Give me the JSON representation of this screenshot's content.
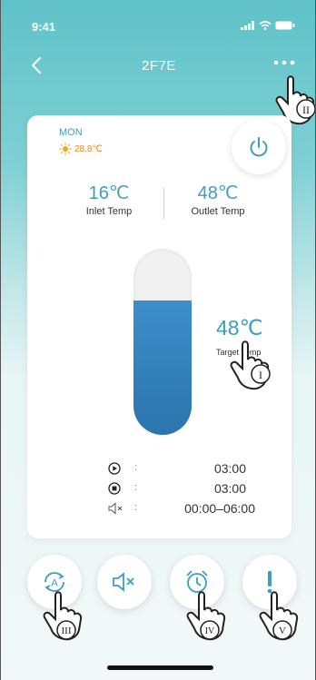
{
  "status_bar": {
    "time": "9:41"
  },
  "nav": {
    "title": "2F7E"
  },
  "card": {
    "day": "MON",
    "weather_temp": "28.8℃",
    "inlet": {
      "value": "16℃",
      "label": "Inlet Temp"
    },
    "outlet": {
      "value": "48℃",
      "label": "Outlet Temp"
    },
    "tank_fill_fraction": 0.72,
    "target": {
      "value": "48℃",
      "label": "Target Temp"
    },
    "schedule": [
      {
        "icon": "play-icon",
        "value": "03:00"
      },
      {
        "icon": "stop-icon",
        "value": "03:00"
      },
      {
        "icon": "mute-icon",
        "value": "00:00–06:00"
      }
    ]
  },
  "bottom_buttons": [
    {
      "name": "auto-mode-button",
      "icon": "auto-mode-icon",
      "marker": "III"
    },
    {
      "name": "mute-button",
      "icon": "speaker-mute-icon",
      "marker": ""
    },
    {
      "name": "timer-button",
      "icon": "alarm-clock-icon",
      "marker": "IV"
    },
    {
      "name": "alert-button",
      "icon": "exclamation-icon",
      "marker": "V"
    }
  ],
  "annotation_markers": {
    "more": "II",
    "target": "I"
  },
  "colors": {
    "accent": "#3d9dc2",
    "tank_fill": "#2c74ad",
    "header": "#5ec2c8",
    "weather": "#e08a1d"
  }
}
